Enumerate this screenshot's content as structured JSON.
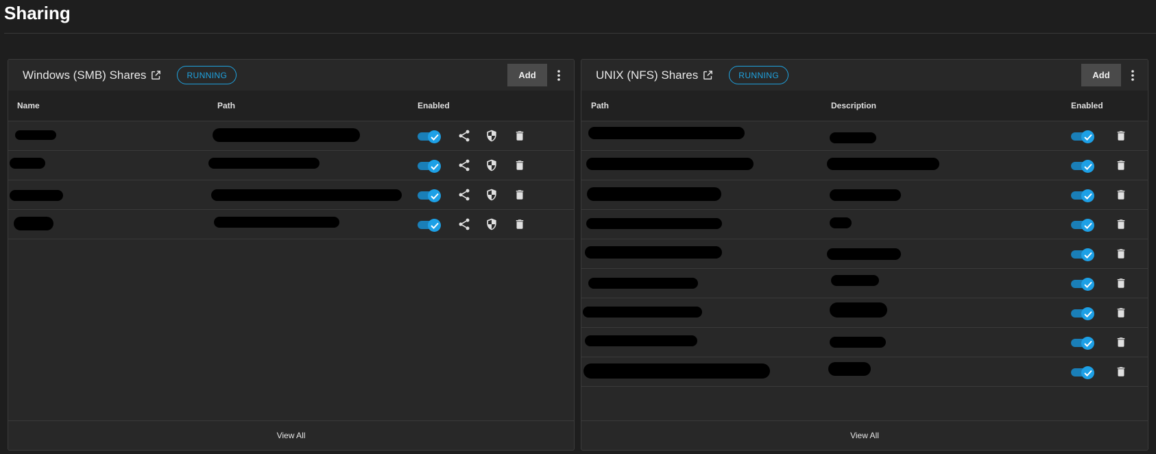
{
  "page": {
    "title": "Sharing"
  },
  "smb": {
    "title": "Windows (SMB) Shares",
    "status": "RUNNING",
    "add_label": "Add",
    "columns": {
      "name": "Name",
      "path": "Path",
      "enabled": "Enabled"
    },
    "rows": [
      {
        "enabled": true
      },
      {
        "enabled": true
      },
      {
        "enabled": true
      },
      {
        "enabled": true
      }
    ],
    "view_all": "View All"
  },
  "nfs": {
    "title": "UNIX (NFS) Shares",
    "status": "RUNNING",
    "add_label": "Add",
    "columns": {
      "path": "Path",
      "description": "Description",
      "enabled": "Enabled"
    },
    "rows": [
      {
        "enabled": true
      },
      {
        "enabled": true
      },
      {
        "enabled": true
      },
      {
        "enabled": true
      },
      {
        "enabled": true
      },
      {
        "enabled": true
      },
      {
        "enabled": true
      },
      {
        "enabled": true
      },
      {
        "enabled": true
      }
    ],
    "view_all": "View All"
  },
  "icons": {
    "external_link": "external-link-icon",
    "more": "more-vert-icon",
    "share": "share-icon",
    "security": "shield-icon",
    "delete": "trash-icon",
    "check": "check-icon"
  },
  "colors": {
    "accent": "#1fa3e0",
    "background": "#1e1e1e",
    "card": "#282828"
  }
}
